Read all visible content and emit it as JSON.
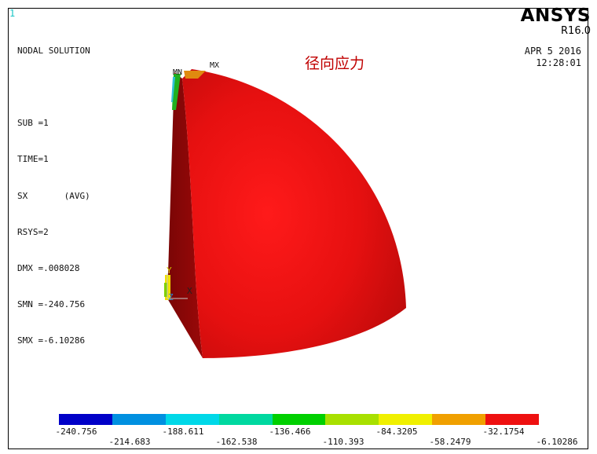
{
  "window_number": "1",
  "info_lines": [
    "NODAL SOLUTION",
    "",
    "SUB =1",
    "TIME=1",
    "SX       (AVG)",
    "RSYS=2",
    "DMX =.008028",
    "SMN =-240.756",
    "SMX =-6.10286"
  ],
  "brand": "ANSYS",
  "revision": "R16.0",
  "date": "APR  5 2016",
  "time": "12:28:01",
  "plot_title": "径向应力",
  "markers": {
    "min": "MN",
    "max": "MX"
  },
  "triad": {
    "x": "X",
    "y": "Y",
    "z": "Z"
  },
  "legend": {
    "colors": [
      "#0000c8",
      "#0090e0",
      "#00d8e8",
      "#00d8a0",
      "#00d000",
      "#a8e000",
      "#f0f000",
      "#f0a000",
      "#ee1010"
    ],
    "values_top": [
      "-240.756",
      "-188.611",
      "-136.466",
      "-84.3205",
      "-32.1754"
    ],
    "values_bottom": [
      "-214.683",
      "-162.538",
      "-110.393",
      "-58.2479",
      "-6.10286"
    ]
  }
}
